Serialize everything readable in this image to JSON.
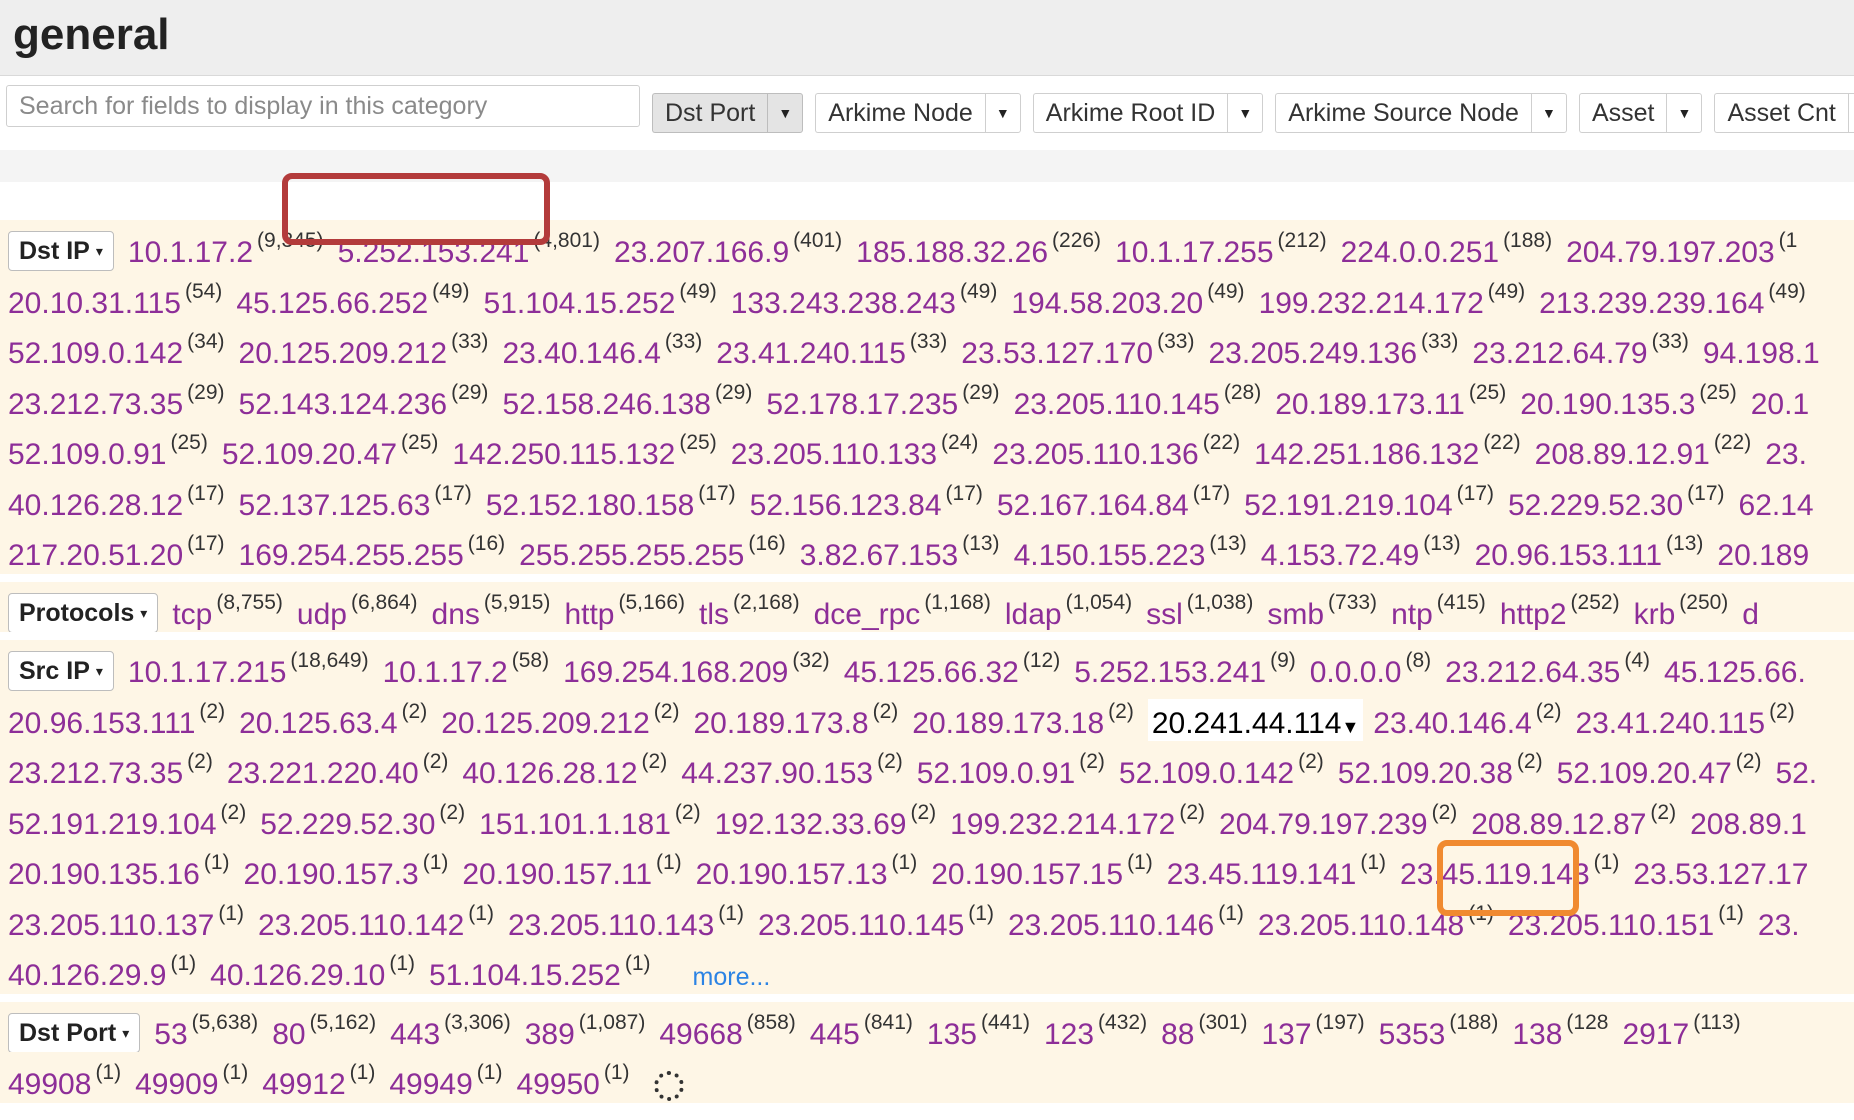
{
  "header": {
    "title": "general"
  },
  "toolbar": {
    "search_placeholder": "Search for fields to display in this category",
    "fields": [
      {
        "label": "Dst Port",
        "active": true
      },
      {
        "label": "Arkime Node"
      },
      {
        "label": "Arkime Root ID"
      },
      {
        "label": "Arkime Source Node"
      },
      {
        "label": "Asset"
      },
      {
        "label": "Asset Cnt"
      }
    ]
  },
  "sections": [
    {
      "label": "Dst IP",
      "rows": [
        [
          [
            "10.1.17.2",
            "(9,345)"
          ],
          [
            "5.252.153.241",
            "(4,801)"
          ],
          [
            "23.207.166.9",
            "(401)"
          ],
          [
            "185.188.32.26",
            "(226)"
          ],
          [
            "10.1.17.255",
            "(212)"
          ],
          [
            "224.0.0.251",
            "(188)"
          ],
          [
            "204.79.197.203",
            "(1"
          ]
        ],
        [
          [
            "20.10.31.115",
            "(54)"
          ],
          [
            "45.125.66.252",
            "(49)"
          ],
          [
            "51.104.15.252",
            "(49)"
          ],
          [
            "133.243.238.243",
            "(49)"
          ],
          [
            "194.58.203.20",
            "(49)"
          ],
          [
            "199.232.214.172",
            "(49)"
          ],
          [
            "213.239.239.164",
            "(49)"
          ]
        ],
        [
          [
            "52.109.0.142",
            "(34)"
          ],
          [
            "20.125.209.212",
            "(33)"
          ],
          [
            "23.40.146.4",
            "(33)"
          ],
          [
            "23.41.240.115",
            "(33)"
          ],
          [
            "23.53.127.170",
            "(33)"
          ],
          [
            "23.205.249.136",
            "(33)"
          ],
          [
            "23.212.64.79",
            "(33)"
          ],
          [
            "94.198.1",
            ""
          ]
        ],
        [
          [
            "23.212.73.35",
            "(29)"
          ],
          [
            "52.143.124.236",
            "(29)"
          ],
          [
            "52.158.246.138",
            "(29)"
          ],
          [
            "52.178.17.235",
            "(29)"
          ],
          [
            "23.205.110.145",
            "(28)"
          ],
          [
            "20.189.173.11",
            "(25)"
          ],
          [
            "20.190.135.3",
            "(25)"
          ],
          [
            "20.1",
            ""
          ]
        ],
        [
          [
            "52.109.0.91",
            "(25)"
          ],
          [
            "52.109.20.47",
            "(25)"
          ],
          [
            "142.250.115.132",
            "(25)"
          ],
          [
            "23.205.110.133",
            "(24)"
          ],
          [
            "23.205.110.136",
            "(22)"
          ],
          [
            "142.251.186.132",
            "(22)"
          ],
          [
            "208.89.12.91",
            "(22)"
          ],
          [
            "23.",
            ""
          ]
        ],
        [
          [
            "40.126.28.12",
            "(17)"
          ],
          [
            "52.137.125.63",
            "(17)"
          ],
          [
            "52.152.180.158",
            "(17)"
          ],
          [
            "52.156.123.84",
            "(17)"
          ],
          [
            "52.167.164.84",
            "(17)"
          ],
          [
            "52.191.219.104",
            "(17)"
          ],
          [
            "52.229.52.30",
            "(17)"
          ],
          [
            "62.14",
            ""
          ]
        ],
        [
          [
            "217.20.51.20",
            "(17)"
          ],
          [
            "169.254.255.255",
            "(16)"
          ],
          [
            "255.255.255.255",
            "(16)"
          ],
          [
            "3.82.67.153",
            "(13)"
          ],
          [
            "4.150.155.223",
            "(13)"
          ],
          [
            "4.153.72.49",
            "(13)"
          ],
          [
            "20.96.153.111",
            "(13)"
          ],
          [
            "20.189",
            ""
          ]
        ]
      ]
    },
    {
      "label": "Protocols",
      "rows": [
        [
          [
            "tcp",
            "(8,755)"
          ],
          [
            "udp",
            "(6,864)"
          ],
          [
            "dns",
            "(5,915)"
          ],
          [
            "http",
            "(5,166)"
          ],
          [
            "tls",
            "(2,168)"
          ],
          [
            "dce_rpc",
            "(1,168)"
          ],
          [
            "ldap",
            "(1,054)"
          ],
          [
            "ssl",
            "(1,038)"
          ],
          [
            "smb",
            "(733)"
          ],
          [
            "ntp",
            "(415)"
          ],
          [
            "http2",
            "(252)"
          ],
          [
            "krb",
            "(250)"
          ],
          [
            "d",
            ""
          ]
        ]
      ]
    },
    {
      "label": "Src IP",
      "rows": [
        [
          [
            "10.1.17.215",
            "(18,649)"
          ],
          [
            "10.1.17.2",
            "(58)"
          ],
          [
            "169.254.168.209",
            "(32)"
          ],
          [
            "45.125.66.32",
            "(12)"
          ],
          [
            "5.252.153.241",
            "(9)"
          ],
          [
            "0.0.0.0",
            "(8)"
          ],
          [
            "23.212.64.35",
            "(4)"
          ],
          [
            "45.125.66.",
            ""
          ]
        ],
        [
          [
            "20.96.153.111",
            "(2)"
          ],
          [
            "20.125.63.4",
            "(2)"
          ],
          [
            "20.125.209.212",
            "(2)"
          ],
          [
            "20.189.173.8",
            "(2)"
          ],
          [
            "20.189.173.18",
            "(2)"
          ],
          [
            "20.241.44.114",
            ""
          ],
          [
            "23.40.146.4",
            "(2)"
          ],
          [
            "23.41.240.115",
            "(2)"
          ]
        ],
        [
          [
            "23.212.73.35",
            "(2)"
          ],
          [
            "23.221.220.40",
            "(2)"
          ],
          [
            "40.126.28.12",
            "(2)"
          ],
          [
            "44.237.90.153",
            "(2)"
          ],
          [
            "52.109.0.91",
            "(2)"
          ],
          [
            "52.109.0.142",
            "(2)"
          ],
          [
            "52.109.20.38",
            "(2)"
          ],
          [
            "52.109.20.47",
            "(2)"
          ],
          [
            "52.",
            ""
          ]
        ],
        [
          [
            "52.191.219.104",
            "(2)"
          ],
          [
            "52.229.52.30",
            "(2)"
          ],
          [
            "151.101.1.181",
            "(2)"
          ],
          [
            "192.132.33.69",
            "(2)"
          ],
          [
            "199.232.214.172",
            "(2)"
          ],
          [
            "204.79.197.239",
            "(2)"
          ],
          [
            "208.89.12.87",
            "(2)"
          ],
          [
            "208.89.1",
            ""
          ]
        ],
        [
          [
            "20.190.135.16",
            "(1)"
          ],
          [
            "20.190.157.3",
            "(1)"
          ],
          [
            "20.190.157.11",
            "(1)"
          ],
          [
            "20.190.157.13",
            "(1)"
          ],
          [
            "20.190.157.15",
            "(1)"
          ],
          [
            "23.45.119.141",
            "(1)"
          ],
          [
            "23.45.119.143",
            "(1)"
          ],
          [
            "23.53.127.17",
            ""
          ]
        ],
        [
          [
            "23.205.110.137",
            "(1)"
          ],
          [
            "23.205.110.142",
            "(1)"
          ],
          [
            "23.205.110.143",
            "(1)"
          ],
          [
            "23.205.110.145",
            "(1)"
          ],
          [
            "23.205.110.146",
            "(1)"
          ],
          [
            "23.205.110.148",
            "(1)"
          ],
          [
            "23.205.110.151",
            "(1)"
          ],
          [
            "23.",
            ""
          ]
        ],
        [
          [
            "40.126.29.9",
            "(1)"
          ],
          [
            "40.126.29.10",
            "(1)"
          ],
          [
            "51.104.15.252",
            "(1)"
          ]
        ]
      ],
      "more_label": "more..."
    },
    {
      "label": "Dst Port",
      "rows": [
        [
          [
            "53",
            "(5,638)"
          ],
          [
            "80",
            "(5,162)"
          ],
          [
            "443",
            "(3,306)"
          ],
          [
            "389",
            "(1,087)"
          ],
          [
            "49668",
            "(858)"
          ],
          [
            "445",
            "(841)"
          ],
          [
            "135",
            "(441)"
          ],
          [
            "123",
            "(432)"
          ],
          [
            "88",
            "(301)"
          ],
          [
            "137",
            "(197)"
          ],
          [
            "5353",
            "(188)"
          ],
          [
            "138",
            "(128"
          ],
          [
            "2917",
            "(113)"
          ]
        ],
        [
          [
            "49908",
            "(1)"
          ],
          [
            "49909",
            "(1)"
          ],
          [
            "49912",
            "(1)"
          ],
          [
            "49949",
            "(1)"
          ],
          [
            "49950",
            "(1)"
          ]
        ]
      ]
    }
  ],
  "hover_value": "20.241.44.114",
  "highlight_colors": {
    "red": "#b33b3b",
    "orange": "#f08a30"
  }
}
